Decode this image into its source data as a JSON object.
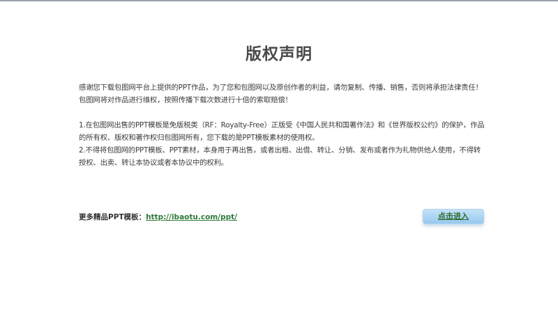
{
  "notice": {
    "title": "版权声明",
    "intro": "感谢您下载包图网平台上提供的PPT作品，为了您和包图网以及原创作者的利益，请勿复制、传播、销售，否则将承担法律责任！包图网将对作品进行维权，按照传播下载次数进行十倍的索取赔偿！",
    "terms": "1.在包图网出售的PPT模板是免版税类（RF：Royalty-Free）正版受《中国人民共和国著作法》和《世界版权公约》的保护，作品的所有权、版权和著作权归包图网所有，您下载的是PPT模板素材的使用权。\n2.不得将包图网的PPT模板、PPT素材，本身用于再出售，或者出租、出借、转让、分销、发布或者作为礼物供他人使用，不得转授权、出卖、转让本协议或者本协议中的权利。"
  },
  "footer": {
    "more_label": "更多精品PPT模板：",
    "more_link": "http://ibaotu.com/ppt/",
    "enter_button": "点击进入"
  }
}
